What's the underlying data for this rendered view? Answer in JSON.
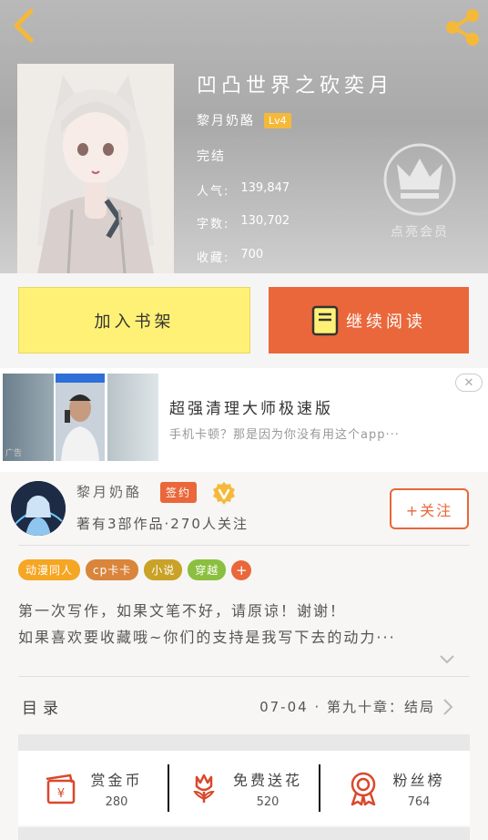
{
  "header": {
    "book_title": "凹凸世界之砍奕月",
    "author": "黎月奶酪",
    "level": "Lv4",
    "status": "完结",
    "stats": [
      {
        "label": "人气:",
        "value": "139,847"
      },
      {
        "label": "字数:",
        "value": "130,702"
      },
      {
        "label": "收藏:",
        "value": "700"
      }
    ],
    "vip_label": "点亮会员"
  },
  "actions": {
    "add_shelf": "加入书架",
    "continue_read": "继续阅读"
  },
  "ad": {
    "title": "超强清理大师极速版",
    "desc": "手机卡顿？那是因为你没有用这个app···",
    "close": "✕",
    "tag": "广告"
  },
  "author_card": {
    "name": "黎月奶酪",
    "badge": "签约",
    "works": "著有3部作品·270人关注",
    "follow": "+关注",
    "tags": [
      {
        "label": "动漫同人",
        "color": "#f5a623"
      },
      {
        "label": "cp卡卡",
        "color": "#d9853b"
      },
      {
        "label": "小说",
        "color": "#c9a227"
      },
      {
        "label": "穿越",
        "color": "#8bbf3f"
      }
    ],
    "tag_more": "+",
    "intro_line1": "第一次写作，如果文笔不好，请原谅！谢谢！",
    "intro_line2": "如果喜欢要收藏哦~你们的支持是我写下去的动力···"
  },
  "toc": {
    "label": "目录",
    "latest": "07-04 · 第九十章：结局"
  },
  "bottom_stats": [
    {
      "name": "赏金币",
      "value": "280",
      "icon": "coin-envelope-icon"
    },
    {
      "name": "免费送花",
      "value": "520",
      "icon": "flower-icon"
    },
    {
      "name": "粉丝榜",
      "value": "764",
      "icon": "medal-icon"
    }
  ],
  "colors": {
    "accent": "#e9673a",
    "shelf_button": "#fff176",
    "level_badge": "#f5b93a"
  }
}
